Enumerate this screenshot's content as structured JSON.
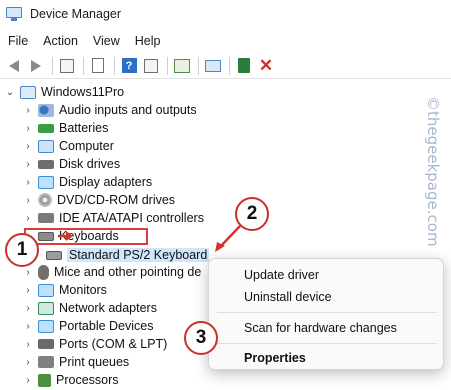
{
  "window": {
    "title": "Device Manager"
  },
  "menu": [
    "File",
    "Action",
    "View",
    "Help"
  ],
  "toolbar": {
    "buttons": [
      "back-icon",
      "forward-icon",
      "properties-sheet-icon",
      "document-icon",
      "help-icon",
      "action-pane-icon",
      "scan-icon",
      "monitor-icon",
      "update-driver-icon",
      "uninstall-icon"
    ]
  },
  "tree": {
    "root": "Windows11Pro",
    "items": [
      {
        "label": "Audio inputs and outputs",
        "icon": "speaker-icon"
      },
      {
        "label": "Batteries",
        "icon": "battery-icon"
      },
      {
        "label": "Computer",
        "icon": "computer-icon"
      },
      {
        "label": "Disk drives",
        "icon": "disk-drive-icon"
      },
      {
        "label": "Display adapters",
        "icon": "display-adapter-icon"
      },
      {
        "label": "DVD/CD-ROM drives",
        "icon": "dvd-icon"
      },
      {
        "label": "IDE ATA/ATAPI controllers",
        "icon": "ide-controller-icon"
      },
      {
        "label": "Keyboards",
        "icon": "keyboard-icon"
      },
      {
        "label": "Mice and other pointing de",
        "icon": "mouse-icon"
      },
      {
        "label": "Monitors",
        "icon": "monitor-icon"
      },
      {
        "label": "Network adapters",
        "icon": "network-adapter-icon"
      },
      {
        "label": "Portable Devices",
        "icon": "portable-device-icon"
      },
      {
        "label": "Ports (COM & LPT)",
        "icon": "port-icon"
      },
      {
        "label": "Print queues",
        "icon": "printer-icon"
      },
      {
        "label": "Processors",
        "icon": "processor-icon"
      }
    ],
    "child": {
      "label": "Standard PS/2 Keyboard",
      "icon": "keyboard-icon"
    }
  },
  "context_menu": {
    "items": [
      "Update driver",
      "Uninstall device",
      "Scan for hardware changes",
      "Properties"
    ]
  },
  "badges": [
    "1",
    "2",
    "3"
  ],
  "watermark": "©thegeekpage.com",
  "colors": {
    "annotation": "#c9302c",
    "highlight_box": "#e03b3b",
    "selection": "#cfe6fb"
  }
}
